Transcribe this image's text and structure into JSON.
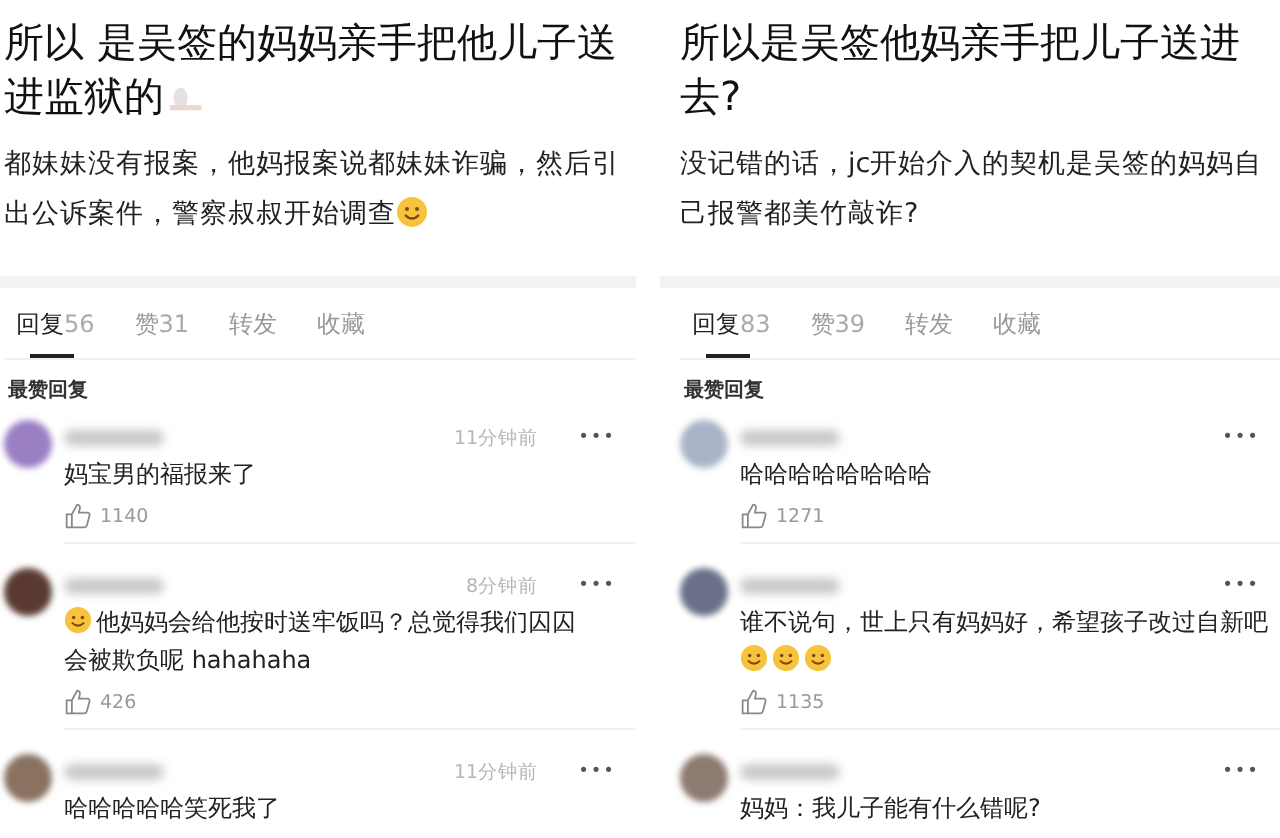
{
  "posts": [
    {
      "title": [
        {
          "kind": "text",
          "text": "所以 是吴签的妈妈亲手把他儿子送进监狱的"
        },
        {
          "kind": "sticker"
        }
      ],
      "body": [
        {
          "kind": "text",
          "text": "都妹妹没有报案，他妈报案说都妹妹诈骗，然后引出公诉案件，警察叔叔开始调查"
        },
        {
          "kind": "emoji"
        }
      ],
      "tabs": [
        {
          "label": "回复",
          "count": "56",
          "selected": true
        },
        {
          "label": "赞",
          "count": "31",
          "selected": false
        },
        {
          "label": "转发",
          "selected": false
        },
        {
          "label": "收藏",
          "selected": false
        }
      ],
      "section_label": "最赞回复",
      "comments": [
        {
          "time": "11分钟前",
          "more": "•••",
          "text": [
            {
              "kind": "text",
              "text": "妈宝男的福报来了"
            }
          ],
          "likes": "1140"
        },
        {
          "time": "8分钟前",
          "more": "•••",
          "text": [
            {
              "kind": "emoji"
            },
            {
              "kind": "text",
              "text": "他妈妈会给他按时送牢饭吗？总觉得我们囚囚会被欺负呢 hahahaha"
            }
          ],
          "likes": "426"
        },
        {
          "time": "11分钟前",
          "more": "•••",
          "text": [
            {
              "kind": "text",
              "text": "哈哈哈哈哈笑死我了"
            }
          ]
        }
      ]
    },
    {
      "title": [
        {
          "kind": "text",
          "text": "所以是吴签他妈亲手把儿子送进去?"
        }
      ],
      "body": [
        {
          "kind": "text",
          "text": "没记错的话，jc开始介入的契机是吴签的妈妈自己报警都美竹敲诈?"
        }
      ],
      "tabs": [
        {
          "label": "回复",
          "count": "83",
          "selected": true
        },
        {
          "label": "赞",
          "count": "39",
          "selected": false
        },
        {
          "label": "转发",
          "selected": false
        },
        {
          "label": "收藏",
          "selected": false
        }
      ],
      "section_label": "最赞回复",
      "comments": [
        {
          "more": "•••",
          "text": [
            {
              "kind": "text",
              "text": "哈哈哈哈哈哈哈哈"
            }
          ],
          "likes": "1271"
        },
        {
          "more": "•••",
          "text": [
            {
              "kind": "text",
              "text": "谁不说句，世上只有妈妈好，希望孩子改过自新吧"
            },
            {
              "kind": "break"
            },
            {
              "kind": "emoji"
            },
            {
              "kind": "emoji"
            },
            {
              "kind": "emoji"
            }
          ],
          "likes": "1135"
        },
        {
          "more": "•••",
          "text": [
            {
              "kind": "text",
              "text": "妈妈：我儿子能有什么错呢?"
            }
          ]
        }
      ]
    }
  ]
}
